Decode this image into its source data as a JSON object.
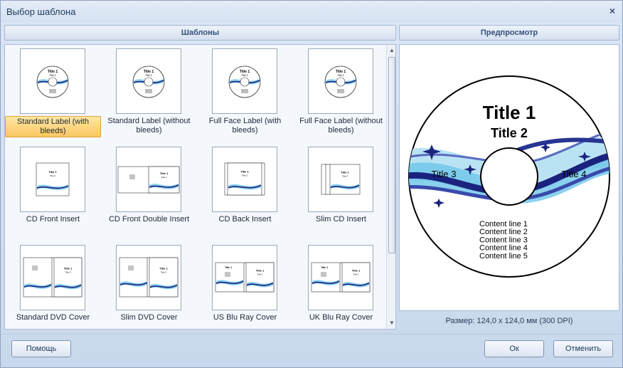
{
  "window": {
    "title": "Выбор шаблона",
    "close_glyph": "×"
  },
  "gallery": {
    "header": "Шаблоны",
    "items": [
      {
        "label": "Standard Label (with bleeds)",
        "kind": "disc",
        "selected": true
      },
      {
        "label": "Standard Label (without bleeds)",
        "kind": "disc",
        "selected": false
      },
      {
        "label": "Full Face Label (with bleeds)",
        "kind": "disc-full",
        "selected": false
      },
      {
        "label": "Full Face Label (without bleeds)",
        "kind": "disc-full",
        "selected": false
      },
      {
        "label": "CD Front Insert",
        "kind": "front",
        "selected": false
      },
      {
        "label": "CD Front Double Insert",
        "kind": "double",
        "selected": false
      },
      {
        "label": "CD Back Insert",
        "kind": "back",
        "selected": false
      },
      {
        "label": "Slim CD Insert",
        "kind": "slim",
        "selected": false
      },
      {
        "label": "Standard DVD Cover",
        "kind": "dvd",
        "selected": false
      },
      {
        "label": "Slim DVD Cover",
        "kind": "slimdvd",
        "selected": false
      },
      {
        "label": "US Blu Ray Cover",
        "kind": "bluray",
        "selected": false
      },
      {
        "label": "UK Blu Ray Cover",
        "kind": "bluray",
        "selected": false
      }
    ],
    "thumb_text": {
      "title1": "Title 1",
      "title2": "Title 2"
    }
  },
  "preview": {
    "header": "Предпросмотр",
    "title1": "Title 1",
    "title2": "Title 2",
    "title3": "Title 3",
    "title4": "Title 4",
    "content_lines": [
      "Content line 1",
      "Content line 2",
      "Content line 3",
      "Content line 4",
      "Content line 5"
    ],
    "size_text": "Размер: 124,0 x 124,0 мм (300 DPI)"
  },
  "buttons": {
    "help": "Помощь",
    "ok": "Ок",
    "cancel": "Отменить"
  },
  "colors": {
    "accent_dark_blue": "#1a237e",
    "accent_light_blue": "#6ec6e8",
    "selection": "#fbc662"
  }
}
